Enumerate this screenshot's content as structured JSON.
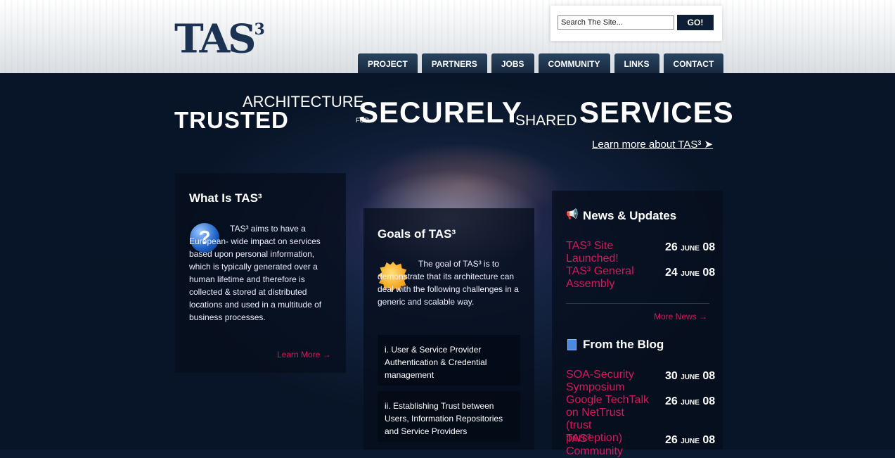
{
  "header": {
    "logo_text": "TAS",
    "logo_sup": "3",
    "search": {
      "placeholder": "Search The Site...",
      "value": "Search The Site...",
      "button": "GO!"
    },
    "nav": [
      "PROJECT",
      "PARTNERS",
      "JOBS",
      "COMMUNITY",
      "LINKS",
      "CONTACT"
    ]
  },
  "tagline": {
    "trusted": "TRUSTED",
    "architecture": "ARCHITECTURE",
    "for": "FOR",
    "securely": "SECURELY",
    "shared": "SHARED",
    "services": "SERVICES",
    "learn_more": "Learn more about TAS³"
  },
  "what_is": {
    "title": "What Is TAS³",
    "body": "TAS³ aims to have a European- wide impact on services based upon personal information, which is typically generated over a human lifetime and therefore is collected & stored at distributed locations and used in a multitude of business processes.",
    "learn_more": "Learn More →"
  },
  "goals": {
    "title": "Goals of TAS³",
    "body": "The goal of TAS³ is to demonstrate that its architecture can deal with the following challenges in a generic and scalable way.",
    "challenges": [
      "i.  User & Service Provider Authentication & Credential management",
      "ii.  Establishing Trust between Users, Information Repositories and Service Providers"
    ]
  },
  "news": {
    "title": "News & Updates",
    "items": [
      {
        "title": "TAS³ Site Launched!",
        "day": "26",
        "month": "JUNE",
        "year": "08"
      },
      {
        "title": "TAS³ General Assembly",
        "day": "24",
        "month": "JUNE",
        "year": "08"
      }
    ],
    "more": "More News →"
  },
  "blog": {
    "title": "From the Blog",
    "items": [
      {
        "title": "SOA-Security Symposium",
        "day": "30",
        "month": "JUNE",
        "year": "08"
      },
      {
        "title": "Google TechTalk on NetTrust (trust perception)",
        "day": "26",
        "month": "JUNE",
        "year": "08"
      },
      {
        "title": "TAS³ Community",
        "day": "26",
        "month": "JUNE",
        "year": "08"
      }
    ]
  }
}
